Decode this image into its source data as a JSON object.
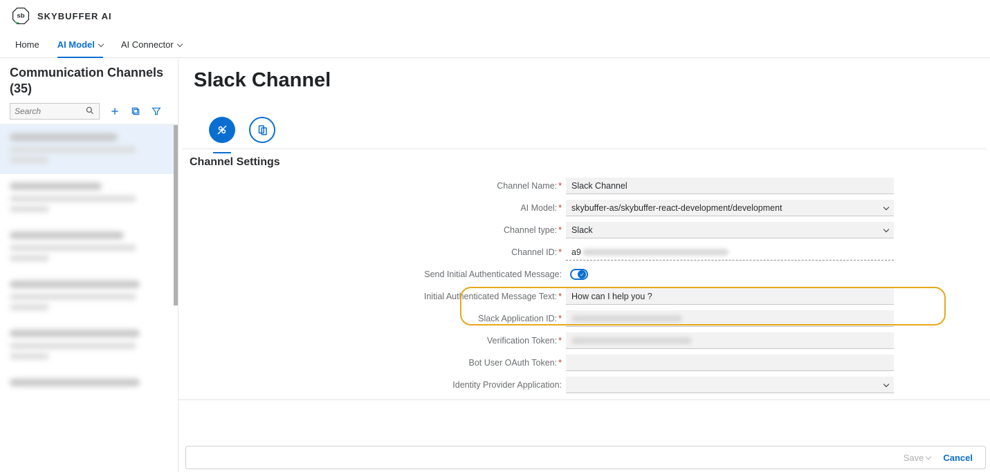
{
  "app": {
    "brand": "SKYBUFFER AI"
  },
  "nav": {
    "home": "Home",
    "ai_model": "AI Model",
    "ai_connector": "AI Connector"
  },
  "sidebar": {
    "title": "Communication Channels (35)",
    "search_placeholder": "Search"
  },
  "page": {
    "title": "Slack Channel",
    "section": "Channel Settings"
  },
  "form": {
    "channel_name_label": "Channel Name:",
    "channel_name_value": "Slack Channel",
    "ai_model_label": "AI Model:",
    "ai_model_value": "skybuffer-as/skybuffer-react-development/development",
    "channel_type_label": "Channel type:",
    "channel_type_value": "Slack",
    "channel_id_label": "Channel ID:",
    "channel_id_value": "a9",
    "send_initial_label": "Send Initial Authenticated Message:",
    "initial_text_label": "Initial Authenticated Message Text:",
    "initial_text_value": "How can I help you ?",
    "slack_app_id_label": "Slack Application ID:",
    "verification_token_label": "Verification Token:",
    "bot_token_label": "Bot User OAuth Token:",
    "idp_label": "Identity Provider Application:"
  },
  "footer": {
    "save": "Save",
    "cancel": "Cancel"
  }
}
